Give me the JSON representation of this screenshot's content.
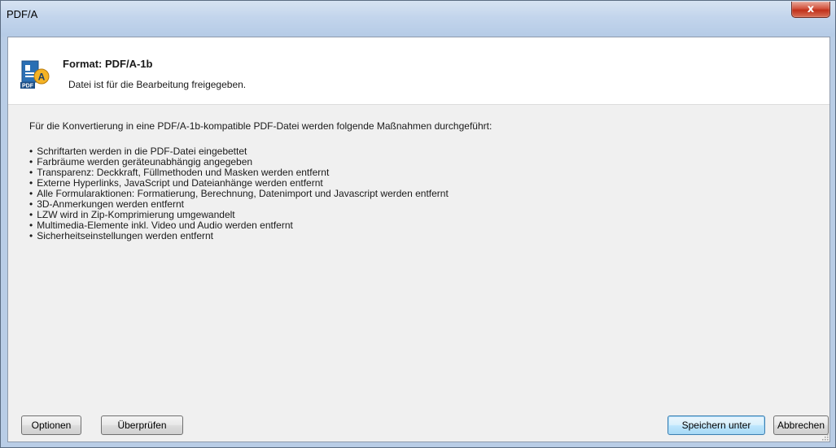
{
  "window": {
    "title": "PDF/A",
    "close_label": "x"
  },
  "header": {
    "icon": "pdfa-format-icon",
    "icon_text_top": "A",
    "icon_text_bottom": "PDF",
    "format_title": "Format: PDF/A-1b",
    "format_status": "Datei ist für die Bearbeitung freigegeben."
  },
  "body": {
    "intro": "Für die Konvertierung in eine PDF/A-1b-kompatible PDF-Datei werden folgende Maßnahmen durchgeführt:",
    "measures": [
      "Schriftarten werden in die PDF-Datei eingebettet",
      "Farbräume werden geräteunabhängig angegeben",
      "Transparenz: Deckkraft, Füllmethoden und Masken werden entfernt",
      "Externe Hyperlinks, JavaScript und Dateianhänge werden entfernt",
      "Alle Formularaktionen: Formatierung, Berechnung, Datenimport und Javascript werden entfernt",
      "3D-Anmerkungen werden entfernt",
      "LZW wird in Zip-Komprimierung umgewandelt",
      "Multimedia-Elemente inkl. Video und Audio werden entfernt",
      "Sicherheitseinstellungen werden entfernt"
    ]
  },
  "buttons": {
    "options": "Optionen",
    "check": "Überprüfen",
    "save_as": "Speichern unter",
    "cancel": "Abbrechen"
  },
  "colors": {
    "title_bar": "#c3d5ec",
    "close_button": "#c0301a",
    "client_background": "#f0f0f0",
    "default_button_border": "#3c7fb1"
  }
}
